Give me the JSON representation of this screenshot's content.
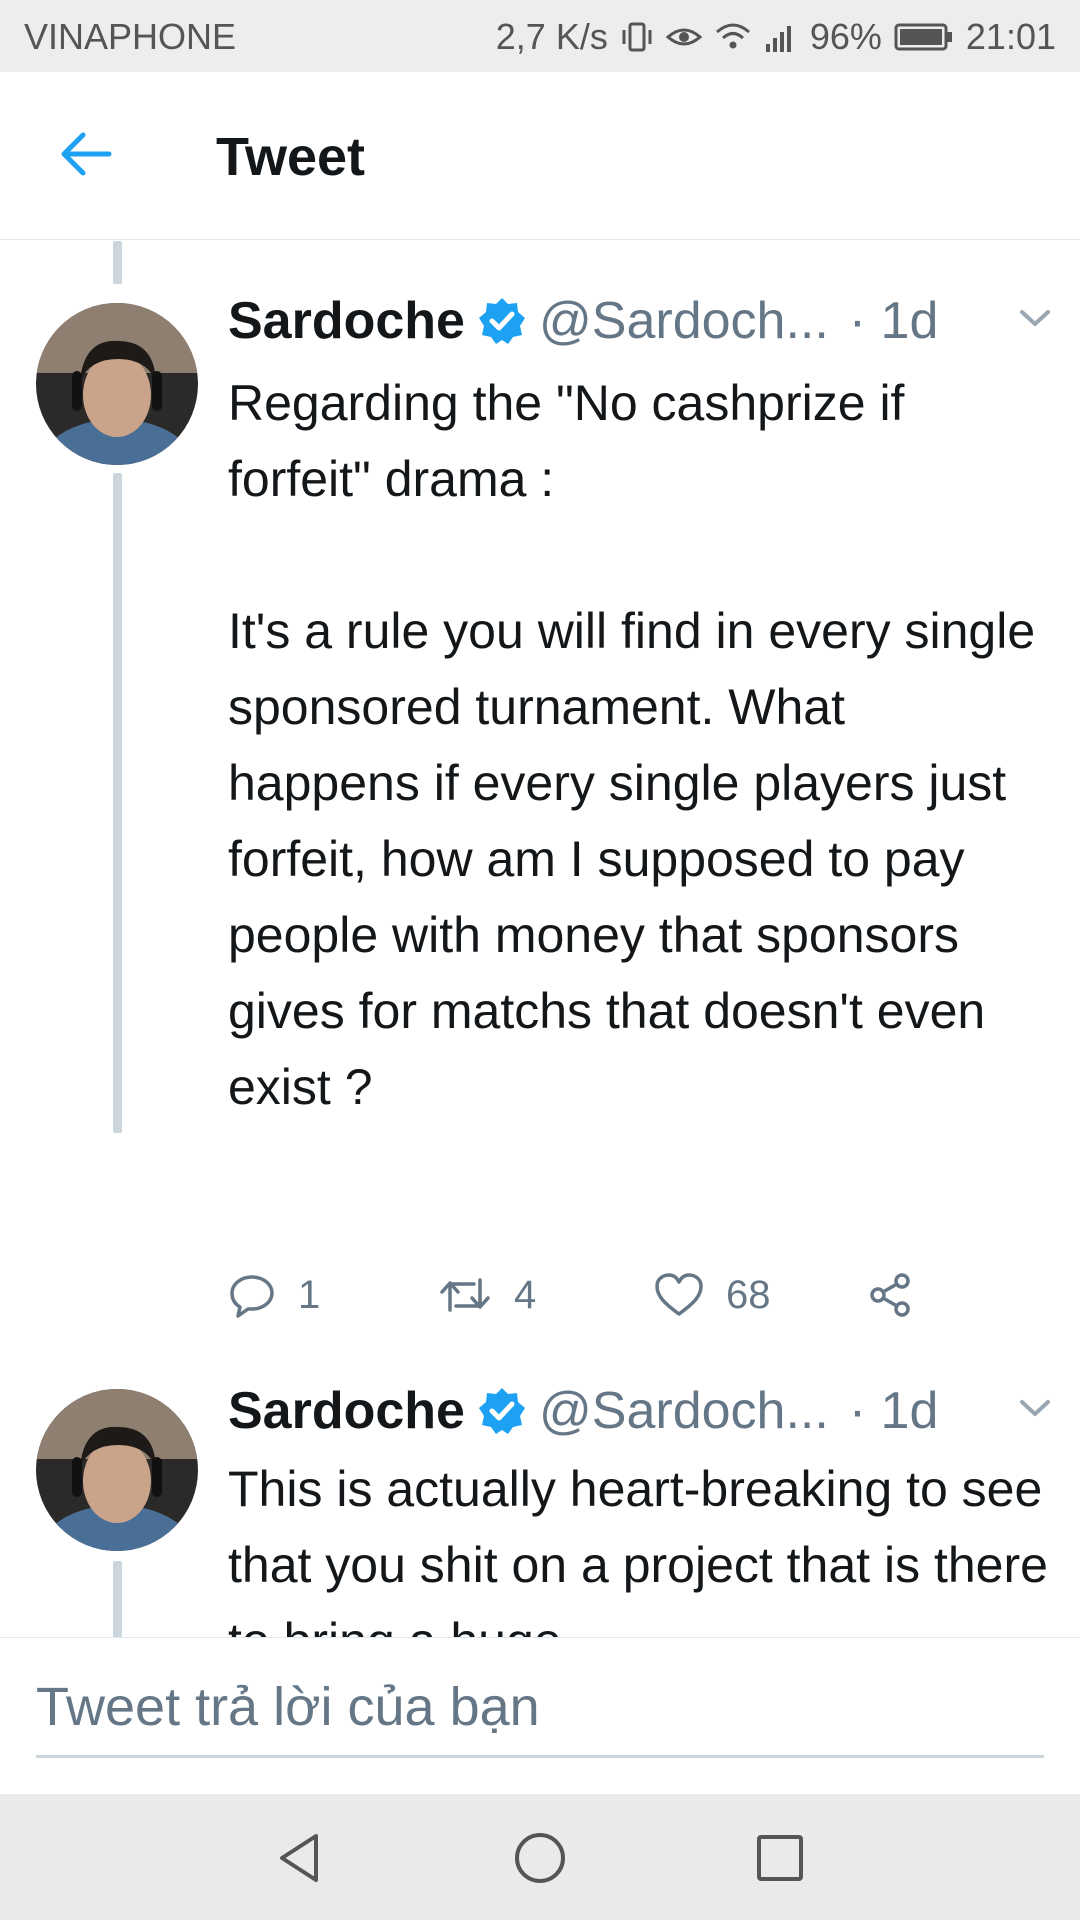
{
  "status_bar": {
    "carrier": "VINAPHONE",
    "speed": "2,7 K/s",
    "battery": "96%",
    "time": "21:01"
  },
  "header": {
    "title": "Tweet",
    "back_icon": "arrow-left-icon"
  },
  "tweets": [
    {
      "name": "Sardoche",
      "handle": "@Sardoch...",
      "time": "· 1d",
      "text": "Regarding the \"No cashprize if forfeit\" drama :\n\nIt's a rule you will find in every single sponsored turnament. What happens if every single players just forfeit, how am I supposed to pay people with money that sponsors gives for matchs that doesn't even exist ?",
      "replies": "1",
      "retweets": "4",
      "likes": "68"
    },
    {
      "name": "Sardoche",
      "handle": "@Sardoch...",
      "time": "· 1d",
      "text": "This is actually heart-breaking to see that you shit on a project that is there to bring a huge"
    }
  ],
  "reply": {
    "placeholder": "Tweet trả lời của bạn"
  },
  "colors": {
    "accent": "#1da1f2",
    "text_primary": "#14171a",
    "text_secondary": "#657786",
    "thread_line": "#ccd6dd",
    "status_bar_bg": "#ededed",
    "nav_bar_bg": "#eaeaea"
  },
  "nav": {
    "back_icon": "triangle-back-icon",
    "home_icon": "circle-home-icon",
    "recents_icon": "square-recents-icon"
  }
}
